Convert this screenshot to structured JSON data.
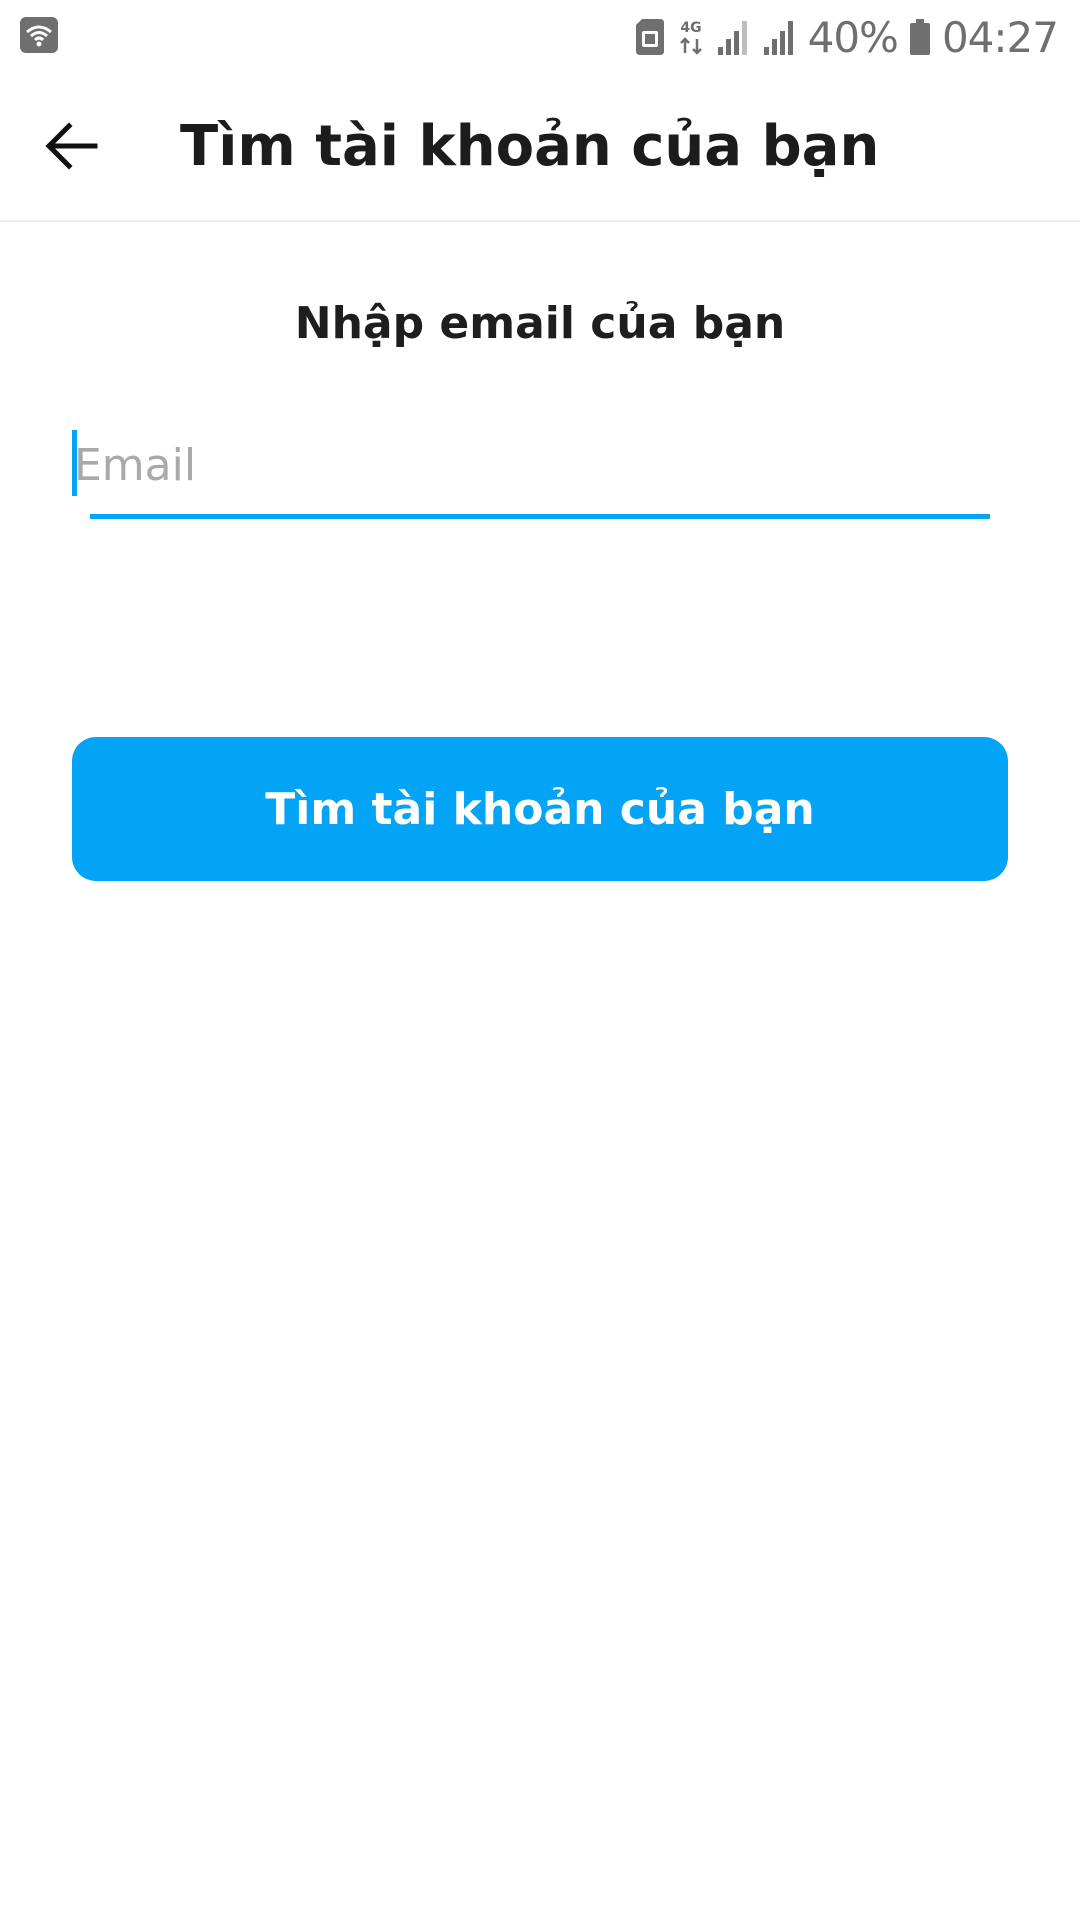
{
  "status_bar": {
    "icons": [
      "wifi-icon",
      "sim-card-icon",
      "network-4g-icon",
      "signal-icon",
      "signal-icon",
      "battery-icon"
    ],
    "network_type": "4G",
    "battery_percent": "40%",
    "time": "04:27"
  },
  "app_bar": {
    "back_icon": "arrow-left-icon",
    "title": "Tìm tài khoản của bạn"
  },
  "form": {
    "prompt": "Nhập email của bạn",
    "email_placeholder": "Email",
    "email_value": "",
    "submit_label": "Tìm tài khoản của bạn"
  },
  "colors": {
    "accent": "#03a4f5",
    "title_text": "#1c1c1c",
    "placeholder": "#a9a9a9",
    "status_icons": "#707070",
    "background": "#ffffff"
  }
}
